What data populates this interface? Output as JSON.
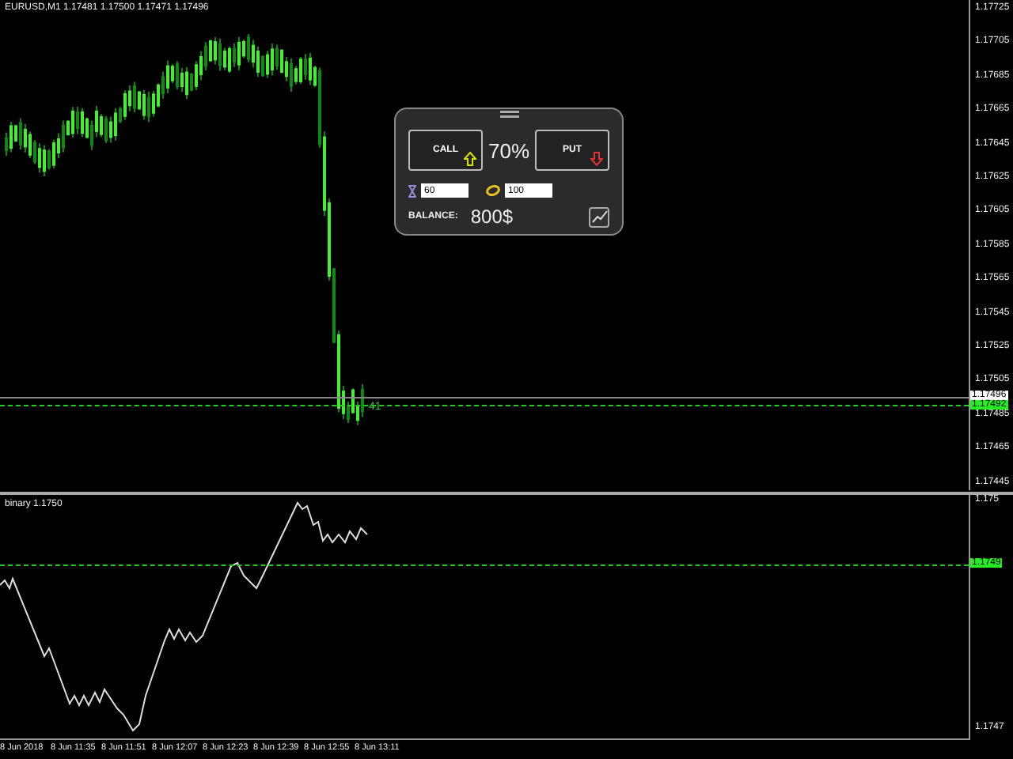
{
  "main_chart": {
    "header": "EURUSD,M1  1.17481 1.17500 1.17471 1.17496",
    "price_labels": [
      "1.17725",
      "1.17705",
      "1.17685",
      "1.17665",
      "1.17645",
      "1.17625",
      "1.17605",
      "1.17585",
      "1.17565",
      "1.17545",
      "1.17525",
      "1.17505",
      "1.17485",
      "1.17465",
      "1.17445"
    ],
    "bid_marker": "1.17496",
    "ask_marker": "1.17492",
    "bar_label": "41"
  },
  "trade_panel": {
    "call_button": "CALL",
    "payout": "70%",
    "put_button": "PUT",
    "expiry_value": "60",
    "amount_value": "100",
    "balance_label": "BALANCE:",
    "balance_value": "800$"
  },
  "indicator": {
    "title": "binary 1.1750",
    "price_labels": [
      "1.175",
      "1.1747"
    ],
    "level_marker": "1.1749"
  },
  "time_axis": [
    "8 Jun 2018",
    "8 Jun 11:35",
    "8 Jun 11:51",
    "8 Jun 12:07",
    "8 Jun 12:23",
    "8 Jun 12:39",
    "8 Jun 12:55",
    "8 Jun 13:11"
  ]
}
